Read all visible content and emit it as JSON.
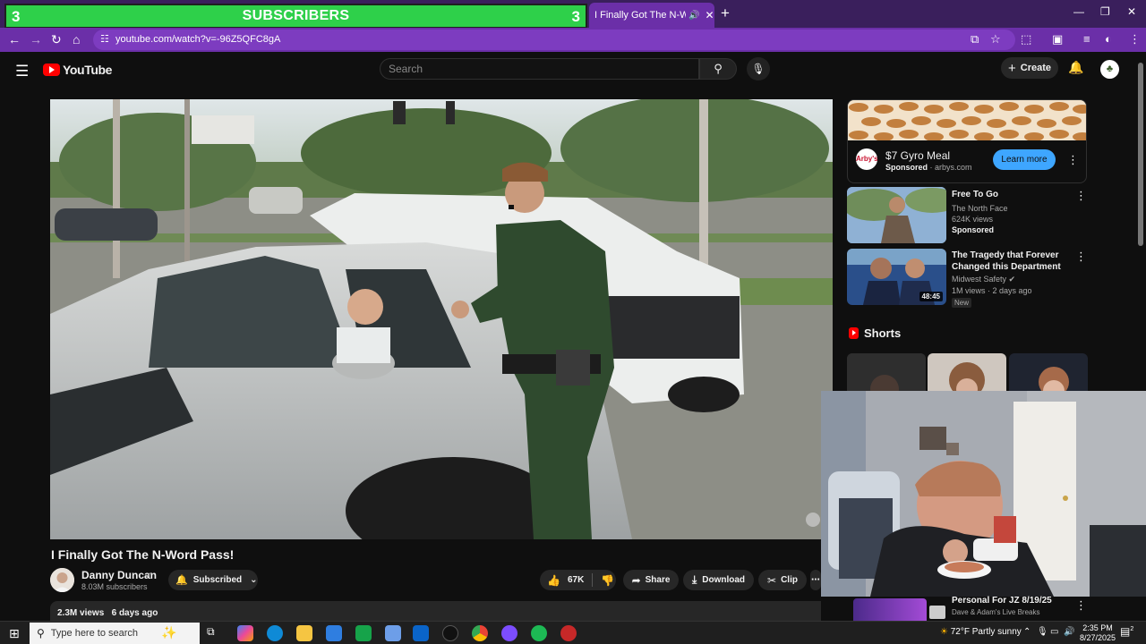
{
  "browser": {
    "overlay_banner": {
      "left_count": "3",
      "label": "SUBSCRIBERS",
      "right_count": "3"
    },
    "active_tab": {
      "title": "I Finally Got The N-Word P",
      "audio_icon": "speaker-icon",
      "close": "✕"
    },
    "new_tab": "+",
    "url": "youtube.com/watch?v=-96Z5QFC8gA",
    "window_controls": {
      "minimize": "—",
      "restore": "❐",
      "close": "✕"
    }
  },
  "youtube": {
    "logo_text": "YouTube",
    "search": {
      "placeholder": "Search",
      "value": ""
    },
    "create_label": "Create",
    "video": {
      "title": "I Finally Got The N-Word Pass!",
      "channel": "Danny Duncan",
      "subscribers": "8.03M subscribers",
      "subscribed_label": "Subscribed",
      "likes": "67K",
      "share_label": "Share",
      "download_label": "Download",
      "clip_label": "Clip",
      "views": "2.3M views",
      "uploaded": "6 days ago"
    },
    "ad": {
      "title": "$7 Gyro Meal",
      "sponsored": "Sponsored",
      "domain": "arbys.com",
      "button": "Learn more",
      "logo_text": "Arby's"
    },
    "recommendations": [
      {
        "title": "Free To Go",
        "channel": "The North Face",
        "views": "624K views",
        "badge": "Sponsored",
        "duration": ""
      },
      {
        "title": "The Tragedy that Forever Changed this Department",
        "channel": "Midwest Safety",
        "views": "1M views · 2 days ago",
        "badge": "New",
        "duration": "48:45"
      }
    ],
    "shorts_title": "Shorts",
    "live_item": {
      "title": "Personal For JZ 8/19/25",
      "channel": "Dave & Adam's Live Breaks"
    }
  },
  "taskbar": {
    "search_placeholder": "Type here to search",
    "weather": "72°F  Partly sunny",
    "time": "2:35 PM",
    "date": "8/27/2025",
    "notification_count": "2"
  },
  "colors": {
    "banner_green": "#2ed04a",
    "tab_purple": "#6b2fa8",
    "yt_red": "#ff0000",
    "learn_more_blue": "#3ea6ff"
  }
}
